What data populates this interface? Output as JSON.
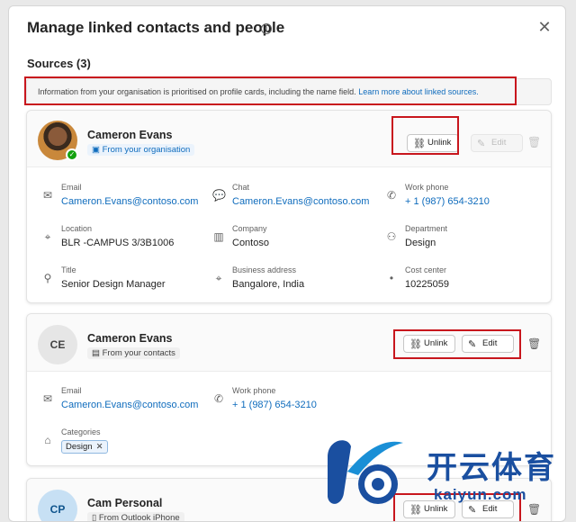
{
  "dialog": {
    "title": "Manage linked contacts and people",
    "sources_heading": "Sources (3)",
    "close_glyph": "✕"
  },
  "banner": {
    "text": "Information from your organisation is prioritised on profile cards, including the name field. ",
    "link_text": "Learn more about linked sources."
  },
  "cards": [
    {
      "name": "Cameron Evans",
      "source": "From your organisation",
      "avatar": "photo",
      "buttons": {
        "unlink": "Unlink",
        "edit": "Edit"
      },
      "edit_disabled": true,
      "fields": [
        {
          "label": "Email",
          "value": "Cameron.Evans@contoso.com",
          "icon": "mail-icon",
          "link": true
        },
        {
          "label": "Chat",
          "value": "Cameron.Evans@contoso.com",
          "icon": "chat-icon",
          "link": true
        },
        {
          "label": "Work phone",
          "value": "+ 1 (987) 654-3210",
          "icon": "phone-icon",
          "link": true
        },
        {
          "label": "Location",
          "value": "BLR -CAMPUS 3/3B1006",
          "icon": "location-icon",
          "link": false
        },
        {
          "label": "Company",
          "value": "Contoso",
          "icon": "building-icon",
          "link": false
        },
        {
          "label": "Department",
          "value": "Design",
          "icon": "people-icon",
          "link": false
        },
        {
          "label": "Title",
          "value": "Senior Design Manager",
          "icon": "person-icon",
          "link": false
        },
        {
          "label": "Business address",
          "value": "Bangalore, India",
          "icon": "location-icon",
          "link": false
        },
        {
          "label": "Cost center",
          "value": "10225059",
          "icon": "dot-icon",
          "link": false
        }
      ]
    },
    {
      "name": "Cameron Evans",
      "initials": "CE",
      "source": "From your contacts",
      "buttons": {
        "unlink": "Unlink",
        "edit": "Edit"
      },
      "fields": [
        {
          "label": "Email",
          "value": "Cameron.Evans@contoso.com",
          "icon": "mail-icon",
          "link": true
        },
        {
          "label": "Work phone",
          "value": "+ 1 (987) 654-3210",
          "icon": "phone-icon",
          "link": true
        }
      ],
      "categories_label": "Categories",
      "categories": [
        "Design"
      ]
    },
    {
      "name": "Cam Personal",
      "initials": "CP",
      "source": "From Outlook iPhone",
      "buttons": {
        "unlink": "Unlink",
        "edit": "Edit"
      }
    }
  ],
  "watermark": {
    "text": "开云体育",
    "url": "kaiyun.com"
  },
  "colors": {
    "accent": "#0f6cbd",
    "highlight": "#c8161d",
    "online": "#13a10e"
  }
}
